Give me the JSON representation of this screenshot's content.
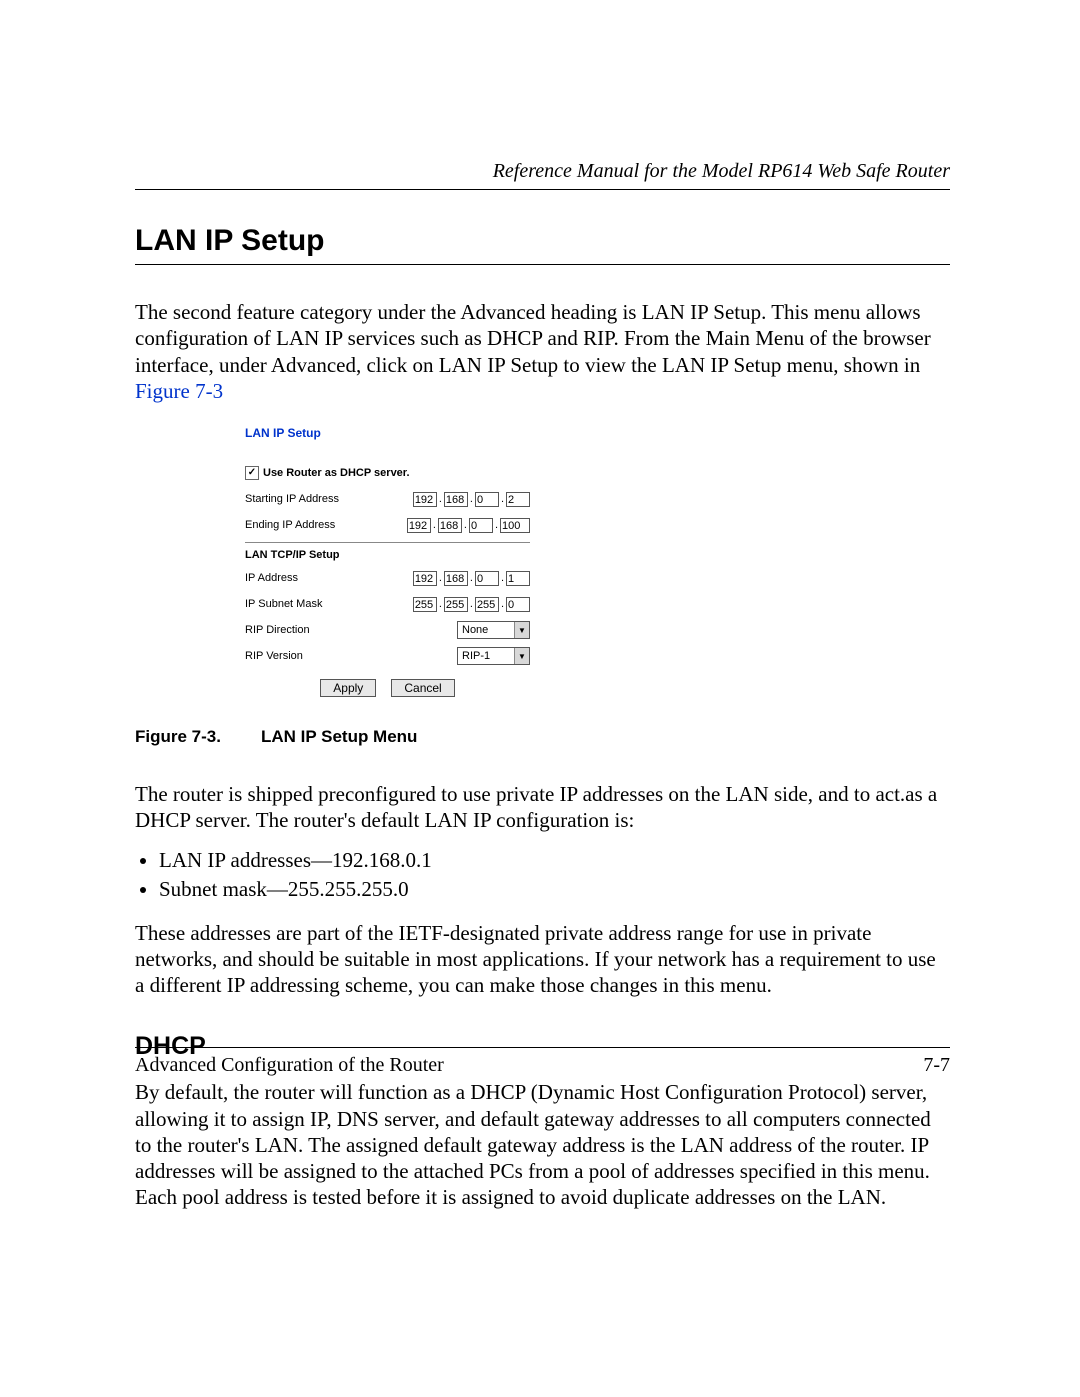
{
  "header": {
    "running": "Reference Manual for the Model RP614 Web Safe Router"
  },
  "section": {
    "title": "LAN IP Setup",
    "intro": "The second feature category under the Advanced heading is LAN IP Setup. This menu allows configuration of LAN IP services such as DHCP and RIP. From the Main Menu of the browser interface, under Advanced, click on LAN IP Setup to view the LAN IP Setup menu, shown in ",
    "figref": "Figure 7-3"
  },
  "panel": {
    "title": "LAN IP Setup",
    "dhcp_label": "Use Router as DHCP server.",
    "dhcp_checked": true,
    "starting_label": "Starting IP Address",
    "starting_ip": [
      "192",
      "168",
      "0",
      "2"
    ],
    "ending_label": "Ending IP Address",
    "ending_ip": [
      "192",
      "168",
      "0",
      "100"
    ],
    "tcpip_heading": "LAN TCP/IP Setup",
    "ip_label": "IP Address",
    "ip": [
      "192",
      "168",
      "0",
      "1"
    ],
    "mask_label": "IP Subnet Mask",
    "mask": [
      "255",
      "255",
      "255",
      "0"
    ],
    "rip_dir_label": "RIP Direction",
    "rip_dir_value": "None",
    "rip_ver_label": "RIP Version",
    "rip_ver_value": "RIP-1",
    "apply": "Apply",
    "cancel": "Cancel"
  },
  "caption": {
    "fig": "Figure 7-3.",
    "text": "LAN IP Setup Menu"
  },
  "after": {
    "p1": "The router is shipped preconfigured to use private IP addresses on the LAN side, and to act.as a DHCP server. The router's default LAN IP configuration is:",
    "li1": "LAN IP addresses—192.168.0.1",
    "li2": "Subnet mask—255.255.255.0",
    "p2": "These addresses are part of the IETF-designated private address range for use in private networks, and should be suitable in most applications. If your network has a requirement to use a different IP addressing scheme, you can make those changes in this menu."
  },
  "dhcp": {
    "title": "DHCP",
    "p": "By default, the router will function as a DHCP (Dynamic Host Configuration Protocol) server, allowing it to assign IP, DNS server, and default gateway addresses to all computers connected to the router's LAN. The assigned default gateway address is the LAN address of the router. IP addresses will be assigned to the attached PCs from a pool of addresses specified in this menu. Each pool address is tested before it is assigned to avoid duplicate addresses on the LAN."
  },
  "footer": {
    "left": "Advanced Configuration of the Router",
    "right": "7-7"
  }
}
